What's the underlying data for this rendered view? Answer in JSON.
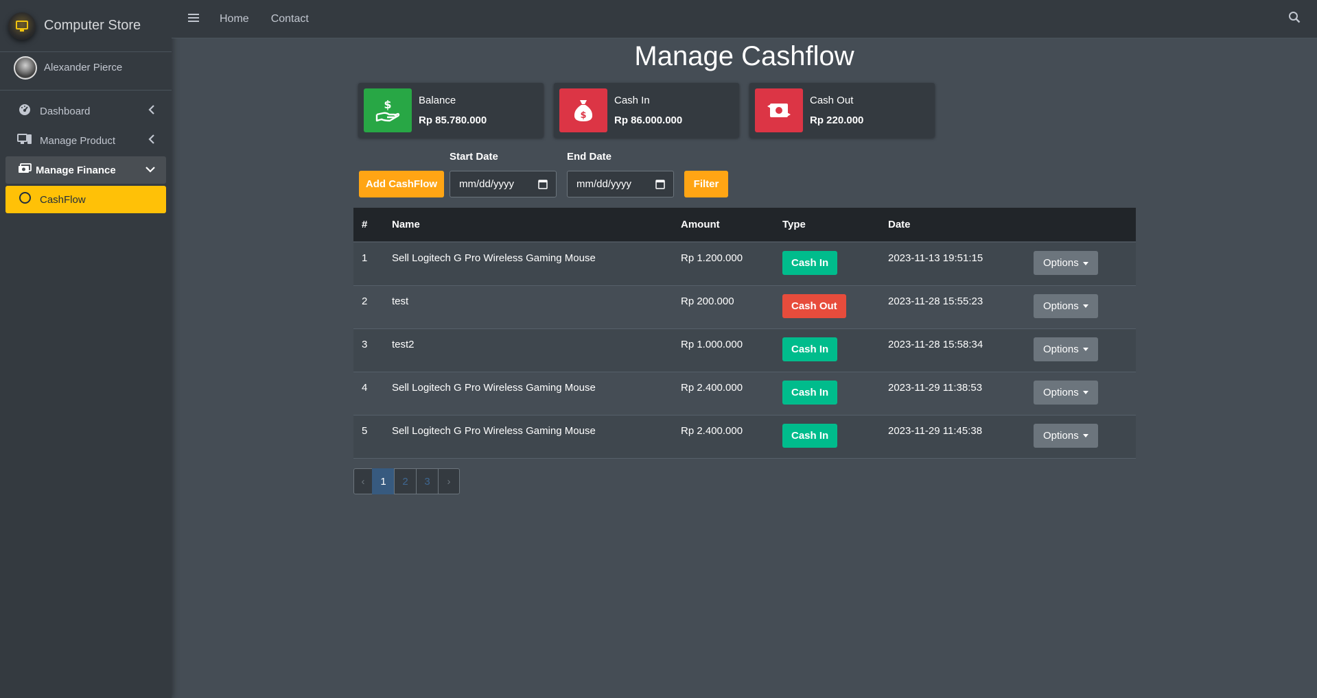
{
  "brand": {
    "name": "Computer Store"
  },
  "user": {
    "name": "Alexander Pierce"
  },
  "sidebar": {
    "items": [
      {
        "label": "Dashboard",
        "icon": "tachometer-icon"
      },
      {
        "label": "Manage Product",
        "icon": "desktop-icon"
      },
      {
        "label": "Manage Finance",
        "icon": "money-bill-icon"
      },
      {
        "label": "CashFlow",
        "icon": "circle-icon"
      }
    ]
  },
  "topbar": {
    "home": "Home",
    "contact": "Contact"
  },
  "page": {
    "title": "Manage Cashflow"
  },
  "summary": {
    "balance": {
      "label": "Balance",
      "value": "Rp 85.780.000",
      "color": "#28a745"
    },
    "cash_in": {
      "label": "Cash In",
      "value": "Rp 86.000.000",
      "color": "#dc3545"
    },
    "cash_out": {
      "label": "Cash Out",
      "value": "Rp 220.000",
      "color": "#dc3545"
    }
  },
  "filters": {
    "add_label": "Add CashFlow",
    "start_label": "Start Date",
    "end_label": "End Date",
    "start_placeholder": "mm/dd/yyyy",
    "end_placeholder": "mm/dd/yyyy",
    "filter_label": "Filter"
  },
  "table": {
    "headers": [
      "#",
      "Name",
      "Amount",
      "Type",
      "Date"
    ],
    "options_label": "Options",
    "rows": [
      {
        "no": "1",
        "name": "Sell Logitech G Pro Wireless Gaming Mouse",
        "amount": "Rp 1.200.000",
        "type": "Cash In",
        "date": "2023-11-13 19:51:15"
      },
      {
        "no": "2",
        "name": "test",
        "amount": "Rp 200.000",
        "type": "Cash Out",
        "date": "2023-11-28 15:55:23"
      },
      {
        "no": "3",
        "name": "test2",
        "amount": "Rp 1.000.000",
        "type": "Cash In",
        "date": "2023-11-28 15:58:34"
      },
      {
        "no": "4",
        "name": "Sell Logitech G Pro Wireless Gaming Mouse",
        "amount": "Rp 2.400.000",
        "type": "Cash In",
        "date": "2023-11-29 11:38:53"
      },
      {
        "no": "5",
        "name": "Sell Logitech G Pro Wireless Gaming Mouse",
        "amount": "Rp 2.400.000",
        "type": "Cash In",
        "date": "2023-11-29 11:45:38"
      }
    ]
  },
  "pagination": {
    "prev": "‹",
    "pages": [
      "1",
      "2",
      "3"
    ],
    "next": "›",
    "current": "1"
  }
}
